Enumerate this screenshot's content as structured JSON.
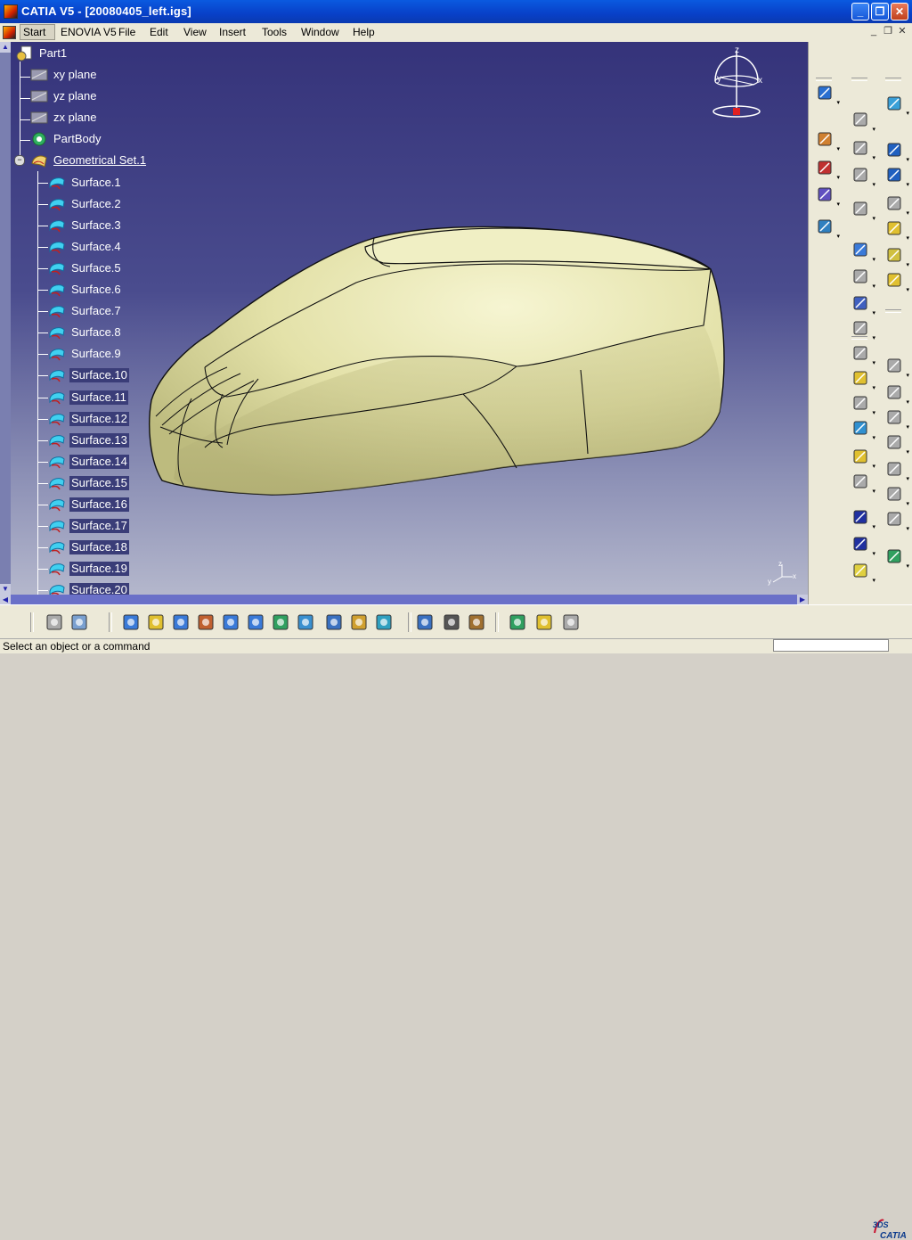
{
  "window": {
    "title": "CATIA V5 - [20080405_left.igs]",
    "minimize_label": "_",
    "restore_label": "❐",
    "close_label": "✕"
  },
  "menubar": {
    "items": [
      "Start",
      "ENOVIA V5",
      "File",
      "Edit",
      "View",
      "Insert",
      "Tools",
      "Window",
      "Help"
    ]
  },
  "tree": {
    "root": "Part1",
    "planes": [
      "xy plane",
      "yz plane",
      "zx plane"
    ],
    "body": "PartBody",
    "geoset": "Geometrical Set.1",
    "surfaces": [
      "Surface.1",
      "Surface.2",
      "Surface.3",
      "Surface.4",
      "Surface.5",
      "Surface.6",
      "Surface.7",
      "Surface.8",
      "Surface.9",
      "Surface.10",
      "Surface.11",
      "Surface.12",
      "Surface.13",
      "Surface.14",
      "Surface.15",
      "Surface.16",
      "Surface.17",
      "Surface.18",
      "Surface.19",
      "Surface.20"
    ],
    "selected_from": 10
  },
  "compass": {
    "x_label": "x",
    "y_label": "y",
    "z_label": "z"
  },
  "axis_triad": {
    "x": "x",
    "y": "y",
    "z": "z"
  },
  "status": {
    "message": "Select an object or a command"
  },
  "brand": {
    "logo_text": "CATIA",
    "logo_prefix": "3DS"
  },
  "colors": {
    "viewport_top": "#35337a",
    "viewport_bottom": "#b4b7cc",
    "surface_fill": "#ecebbb",
    "titlebar": "#0a5ae0",
    "selection": "#3a3d78"
  }
}
